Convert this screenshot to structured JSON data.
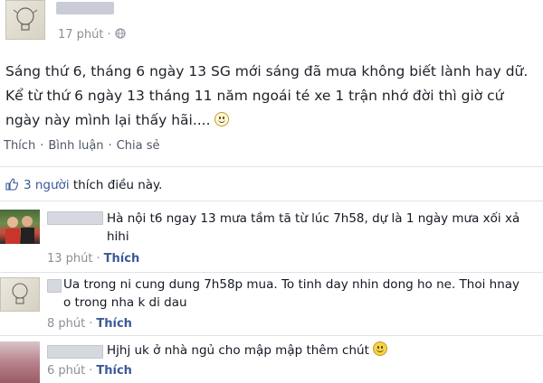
{
  "post": {
    "timestamp": "17 phút",
    "privacy_icon": "globe-icon",
    "text_lines": [
      "Sáng thứ 6, tháng 6 ngày 13 SG mới sáng đã mưa không biết lành hay dữ.",
      "Kể từ thứ 6 ngày 13 tháng 11 năm ngoái té xe 1 trận nhớ đời thì giờ cứ",
      "ngày này mình lại thấy hãi...."
    ]
  },
  "actions": {
    "like": "Thích",
    "comment": "Bình luận",
    "share": "Chia sẻ"
  },
  "likes": {
    "count_text": "3 người",
    "suffix": "thích điều này."
  },
  "comments": [
    {
      "text": "Hà nội t6 ngay 13 mưa tầm tã từ lúc 7h58, dự là 1 ngày mưa xối xả\nhihi",
      "time": "13 phút",
      "like": "Thích"
    },
    {
      "text": "Ua trong ni cung dung 7h58p mua. To tinh day nhin dong ho ne. Thoi hnay\no trong nha k di dau",
      "time": "8 phút",
      "like": "Thích"
    },
    {
      "text": "Hjhj uk ở nhà ngủ cho mập mập thêm chút",
      "time": "6 phút",
      "like": "Thích"
    }
  ]
}
